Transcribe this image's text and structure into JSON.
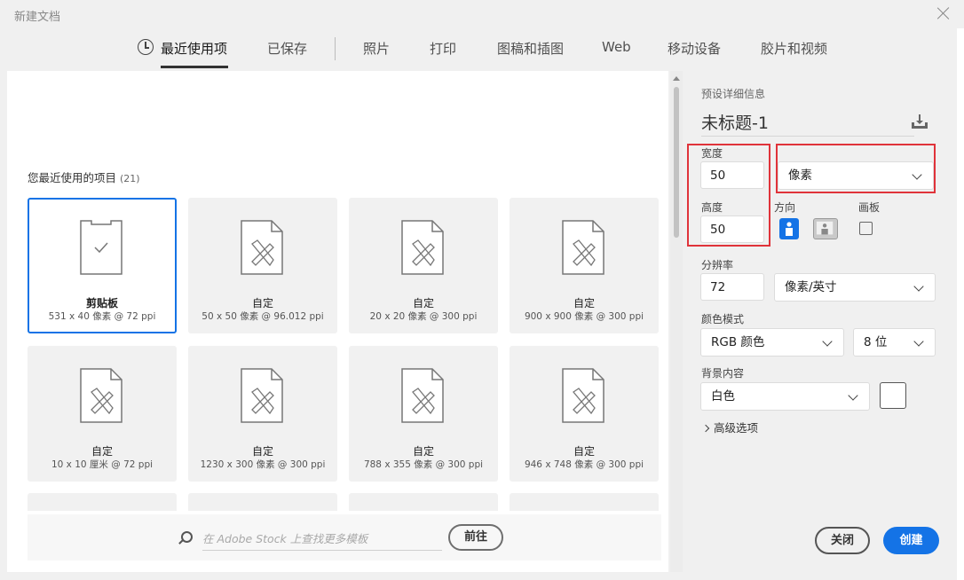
{
  "window": {
    "title": "新建文档"
  },
  "tabs": [
    {
      "label": "最近使用项",
      "active": true
    },
    {
      "label": "已保存"
    },
    {
      "label": "照片"
    },
    {
      "label": "打印"
    },
    {
      "label": "图稿和插图"
    },
    {
      "label": "Web"
    },
    {
      "label": "移动设备"
    },
    {
      "label": "胶片和视频"
    }
  ],
  "recent": {
    "title": "您最近使用的项目",
    "count": "(21)",
    "items": [
      {
        "name": "剪贴板",
        "size": "531 x 40 像素 @ 72 ppi",
        "selected": true
      },
      {
        "name": "自定",
        "size": "50 x 50 像素 @ 96.012 ppi"
      },
      {
        "name": "自定",
        "size": "20 x 20 像素 @ 300 ppi"
      },
      {
        "name": "自定",
        "size": "900 x 900 像素 @ 300 ppi"
      },
      {
        "name": "自定",
        "size": "10 x 10 厘米 @ 72 ppi"
      },
      {
        "name": "自定",
        "size": "1230 x 300 像素 @ 300 ppi"
      },
      {
        "name": "自定",
        "size": "788 x 355 像素 @ 300 ppi"
      },
      {
        "name": "自定",
        "size": "946 x 748 像素 @ 300 ppi"
      }
    ]
  },
  "search": {
    "placeholder": "在 Adobe Stock 上查找更多模板",
    "go_label": "前往"
  },
  "preset": {
    "header": "预设详细信息",
    "name": "未标题-1",
    "width_label": "宽度",
    "width_value": "50",
    "height_label": "高度",
    "height_value": "50",
    "unit": "像素",
    "orientation_label": "方向",
    "artboard_label": "画板",
    "resolution_label": "分辨率",
    "resolution_value": "72",
    "resolution_unit": "像素/英寸",
    "color_mode_label": "颜色模式",
    "color_mode": "RGB 颜色",
    "bit_depth": "8 位",
    "background_label": "背景内容",
    "background": "白色",
    "background_color": "#ffffff",
    "advanced_label": "高级选项"
  },
  "actions": {
    "close_label": "关闭",
    "create_label": "创建"
  },
  "colors": {
    "accent": "#1473e6",
    "highlight": "#e0333a"
  }
}
